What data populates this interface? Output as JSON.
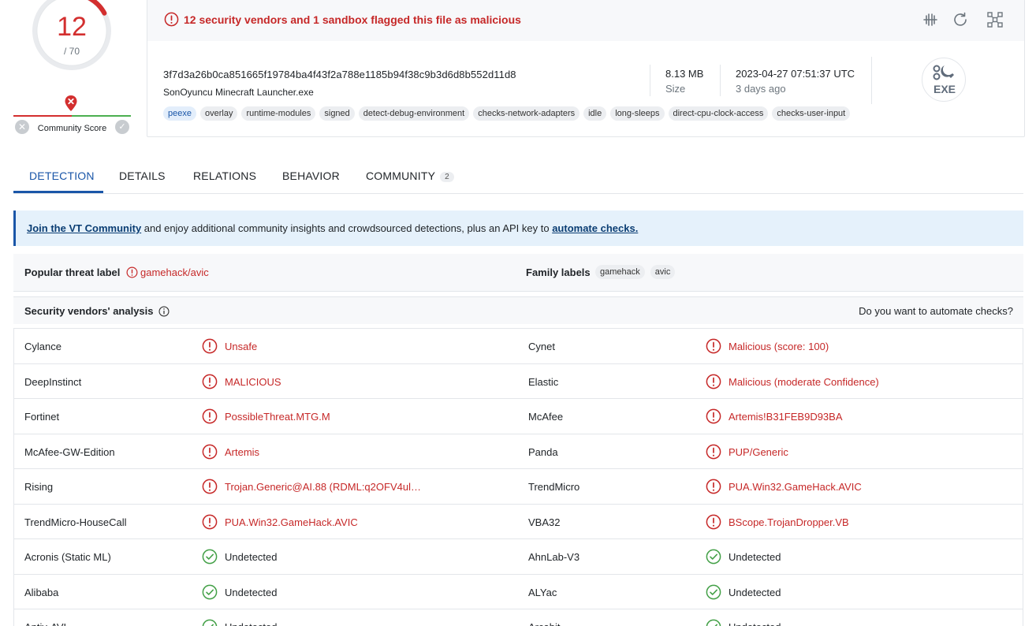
{
  "score": {
    "detections": "12",
    "total": "/ 70",
    "detection_ratio": 0.1714
  },
  "community": {
    "label": "Community Score",
    "negative_icon": "x-icon",
    "positive_icon": "check-icon"
  },
  "file": {
    "flag_message": "12 security vendors and 1 sandbox flagged this file as malicious",
    "hash": "3f7d3a26b0ca851665f19784ba4f43f2a788e1185b94f38c9b3d6d8b552d11d8",
    "name": "SonOyuncu Minecraft Launcher.exe",
    "size_value": "8.13 MB",
    "size_label": "Size",
    "date_value": "2023-04-27 07:51:37 UTC",
    "date_label": "3 days ago",
    "type_badge": "EXE",
    "tags": [
      "peexe",
      "overlay",
      "runtime-modules",
      "signed",
      "detect-debug-environment",
      "checks-network-adapters",
      "idle",
      "long-sleeps",
      "direct-cpu-clock-access",
      "checks-user-input"
    ]
  },
  "toolbar": {
    "icons": [
      "compare-icon",
      "reanalyze-icon",
      "graph-icon"
    ]
  },
  "tabs": [
    {
      "label": "DETECTION"
    },
    {
      "label": "DETAILS"
    },
    {
      "label": "RELATIONS"
    },
    {
      "label": "BEHAVIOR"
    },
    {
      "label": "COMMUNITY",
      "count": "2"
    }
  ],
  "banner": {
    "link1": "Join the VT Community",
    "text": " and enjoy additional community insights and crowdsourced detections, plus an API key to ",
    "link2": "automate checks."
  },
  "threat": {
    "popular_label": "Popular threat label",
    "popular_value": "gamehack/avic",
    "family_label": "Family labels",
    "family_tags": [
      "gamehack",
      "avic"
    ]
  },
  "vendors": {
    "title": "Security vendors' analysis",
    "automate": "Do you want to automate checks?",
    "rows": [
      [
        {
          "name": "Cylance",
          "result": "Unsafe",
          "status": "malicious"
        },
        {
          "name": "Cynet",
          "result": "Malicious (score: 100)",
          "status": "malicious"
        }
      ],
      [
        {
          "name": "DeepInstinct",
          "result": "MALICIOUS",
          "status": "malicious"
        },
        {
          "name": "Elastic",
          "result": "Malicious (moderate Confidence)",
          "status": "malicious"
        }
      ],
      [
        {
          "name": "Fortinet",
          "result": "PossibleThreat.MTG.M",
          "status": "malicious"
        },
        {
          "name": "McAfee",
          "result": "Artemis!B31FEB9D93BA",
          "status": "malicious"
        }
      ],
      [
        {
          "name": "McAfee-GW-Edition",
          "result": "Artemis",
          "status": "malicious"
        },
        {
          "name": "Panda",
          "result": "PUP/Generic",
          "status": "malicious"
        }
      ],
      [
        {
          "name": "Rising",
          "result": "Trojan.Generic@AI.88 (RDML:q2OFV4ul…",
          "status": "malicious"
        },
        {
          "name": "TrendMicro",
          "result": "PUA.Win32.GameHack.AVIC",
          "status": "malicious"
        }
      ],
      [
        {
          "name": "TrendMicro-HouseCall",
          "result": "PUA.Win32.GameHack.AVIC",
          "status": "malicious"
        },
        {
          "name": "VBA32",
          "result": "BScope.TrojanDropper.VB",
          "status": "malicious"
        }
      ],
      [
        {
          "name": "Acronis (Static ML)",
          "result": "Undetected",
          "status": "undetected"
        },
        {
          "name": "AhnLab-V3",
          "result": "Undetected",
          "status": "undetected"
        }
      ],
      [
        {
          "name": "Alibaba",
          "result": "Undetected",
          "status": "undetected"
        },
        {
          "name": "ALYac",
          "result": "Undetected",
          "status": "undetected"
        }
      ],
      [
        {
          "name": "Antiy-AVL",
          "result": "Undetected",
          "status": "undetected"
        },
        {
          "name": "Arcabit",
          "result": "Undetected",
          "status": "undetected"
        }
      ]
    ]
  },
  "colors": {
    "malicious": "#c62828",
    "undetected": "#43a047",
    "accent": "#1a56a8"
  }
}
